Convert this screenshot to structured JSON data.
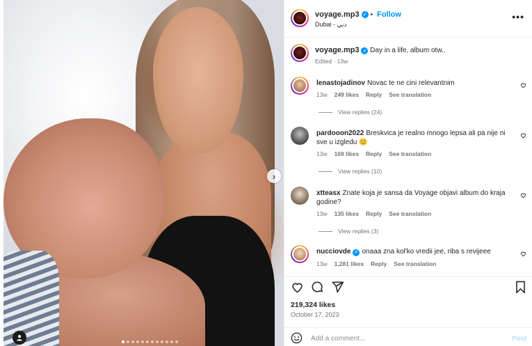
{
  "post": {
    "author": "voyage.mp3",
    "follow_label": "Follow",
    "location": "Dubai - دبي",
    "caption": "Day in a life, album otw..",
    "caption_meta": "Edited · 13w",
    "likes": "219,324 likes",
    "date": "October 17, 2023",
    "carousel": {
      "slides": 12,
      "active_index": 0
    }
  },
  "comments": [
    {
      "username": "lenastojadinov",
      "verified": false,
      "text": "Novac te ne cini relevantnim",
      "age": "13w",
      "likes": "249 likes",
      "reply": "Reply",
      "translate": "See translation",
      "replies": "View replies (24)"
    },
    {
      "username": "pardooon2022",
      "verified": false,
      "text": "Breskvica je realno mnogo lepsa ali pa nije ni sve u izgledu 😊",
      "age": "13w",
      "likes": "169 likes",
      "reply": "Reply",
      "translate": "See translation",
      "replies": "View replies (10)"
    },
    {
      "username": "xtteasx",
      "verified": false,
      "text": "Znate koja je sansa da Voyage objavi album do kraja godine?",
      "age": "13w",
      "likes": "135 likes",
      "reply": "Reply",
      "translate": "See translation",
      "replies": "View replies (3)"
    },
    {
      "username": "nucciovde",
      "verified": true,
      "text": "onaaa zna kol'ko vredii jee, riba s revijeee",
      "age": "13w",
      "likes": "1,281 likes",
      "reply": "Reply",
      "translate": "See translation",
      "replies": ""
    }
  ],
  "composer": {
    "placeholder": "Add a comment...",
    "post_label": "Post"
  },
  "icons": {
    "more": "more-options-icon",
    "next": "chevron-right-icon",
    "tag": "user-tag-icon",
    "like": "heart-icon",
    "comment": "comment-icon",
    "share": "share-icon",
    "save": "bookmark-icon",
    "emoji": "emoji-icon"
  },
  "colors": {
    "link": "#0095f6",
    "muted": "#737373",
    "post_disabled": "#b2dffc"
  }
}
